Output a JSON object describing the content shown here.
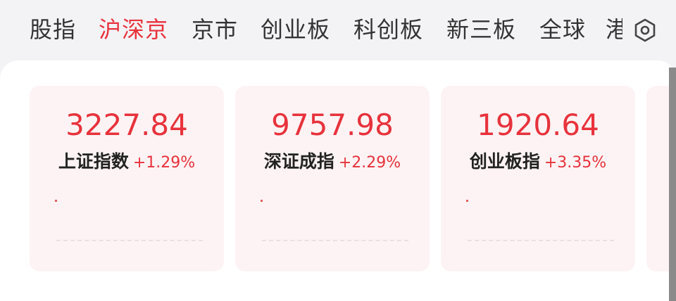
{
  "tabs": [
    {
      "label": "股指",
      "active": false
    },
    {
      "label": "沪深京",
      "active": true
    },
    {
      "label": "京市",
      "active": false
    },
    {
      "label": "创业板",
      "active": false
    },
    {
      "label": "科创板",
      "active": false
    },
    {
      "label": "新三板",
      "active": false
    },
    {
      "label": "全球",
      "active": false
    },
    {
      "label": "港",
      "active": false
    }
  ],
  "settings_icon": "settings-hexagon-icon",
  "colors": {
    "accent": "#e8323c",
    "card_bg": "#fdf3f4",
    "text": "#333333"
  },
  "cards": [
    {
      "value": "3227.84",
      "name": "上证指数",
      "change": "+1.29%"
    },
    {
      "value": "9757.98",
      "name": "深证成指",
      "change": "+2.29%"
    },
    {
      "value": "1920.64",
      "name": "创业板指",
      "change": "+3.35%"
    }
  ]
}
